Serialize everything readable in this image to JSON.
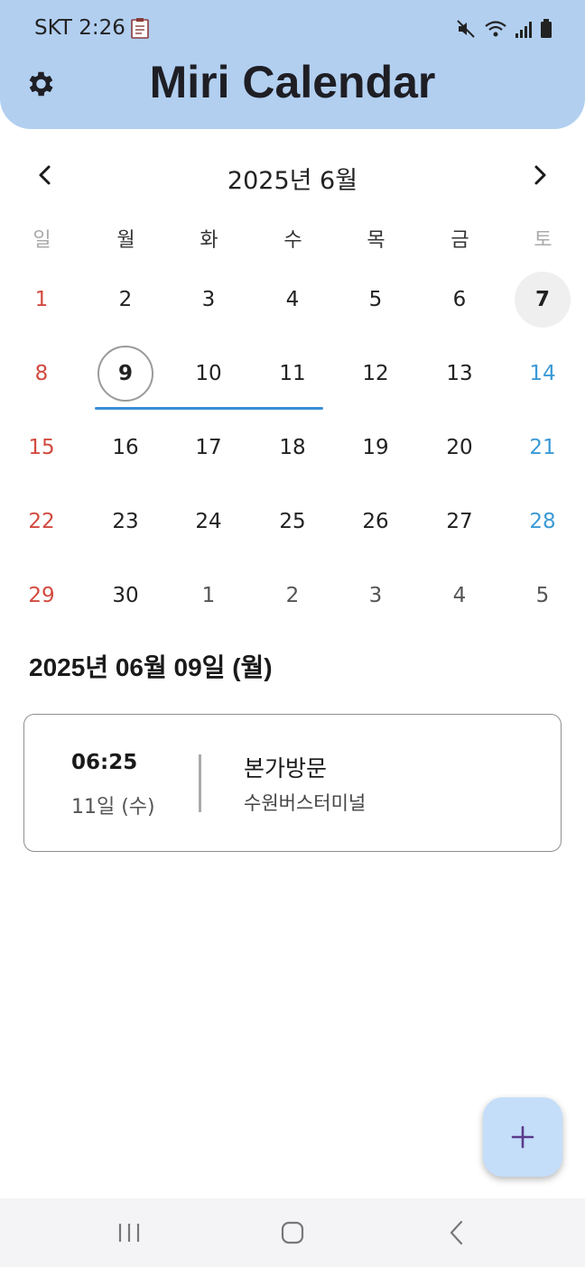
{
  "status_bar": {
    "carrier_time": "SKT 2:26"
  },
  "header": {
    "title": "Miri Calendar"
  },
  "calendar": {
    "month_label": "2025년 6월",
    "weekdays": [
      "일",
      "월",
      "화",
      "수",
      "목",
      "금",
      "토"
    ],
    "weeks": [
      [
        "1",
        "2",
        "3",
        "4",
        "5",
        "6",
        "7"
      ],
      [
        "8",
        "9",
        "10",
        "11",
        "12",
        "13",
        "14"
      ],
      [
        "15",
        "16",
        "17",
        "18",
        "19",
        "20",
        "21"
      ],
      [
        "22",
        "23",
        "24",
        "25",
        "26",
        "27",
        "28"
      ],
      [
        "29",
        "30",
        "1",
        "2",
        "3",
        "4",
        "5"
      ]
    ],
    "today": "7",
    "selected": "9"
  },
  "selected_date_heading": "2025년 06월 09일 (월)",
  "event": {
    "time": "06:25",
    "end_date": "11일 (수)",
    "title": "본가방문",
    "location": "수원버스터미널"
  },
  "colors": {
    "header_bg": "#b2cff0",
    "sunday": "#d24a3f",
    "saturday": "#3b9ad6",
    "event_bar": "#3a8fd6",
    "fab_bg": "#c4defa",
    "fab_icon": "#5a3a8a"
  },
  "icons": {
    "settings": "gear-icon",
    "prev": "chevron-left-icon",
    "next": "chevron-right-icon",
    "add": "plus-icon"
  }
}
